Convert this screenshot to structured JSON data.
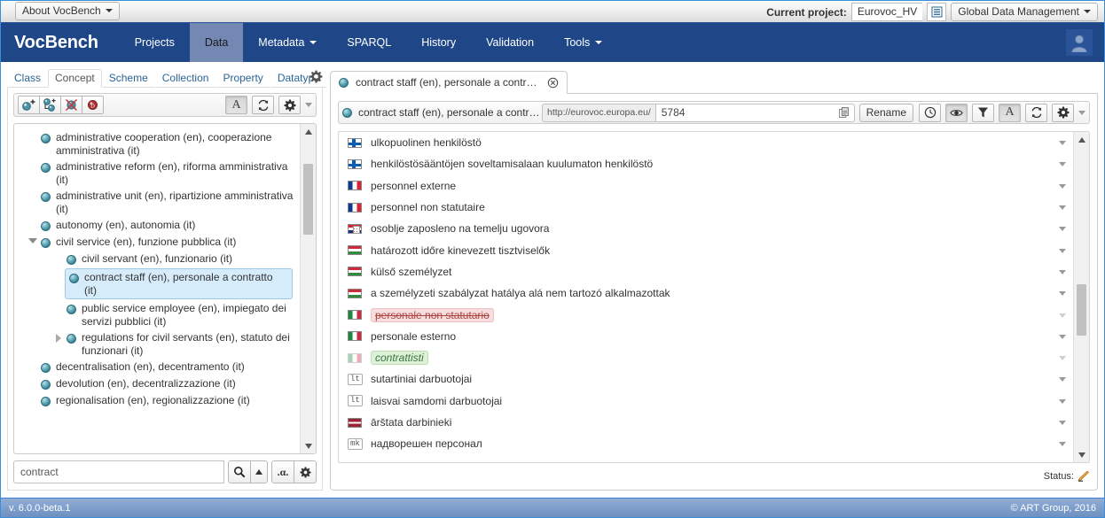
{
  "topbar": {
    "about_label": "About VocBench",
    "current_project_label": "Current project:",
    "project_name": "Eurovoc_HV",
    "project_picker_icon": "list-icon",
    "global_menu_label": "Global Data Management"
  },
  "navbar": {
    "brand": "VocBench",
    "items": [
      {
        "label": "Projects",
        "active": false,
        "has_caret": false
      },
      {
        "label": "Data",
        "active": true,
        "has_caret": false
      },
      {
        "label": "Metadata",
        "active": false,
        "has_caret": true
      },
      {
        "label": "SPARQL",
        "active": false,
        "has_caret": false
      },
      {
        "label": "History",
        "active": false,
        "has_caret": false
      },
      {
        "label": "Validation",
        "active": false,
        "has_caret": false
      },
      {
        "label": "Tools",
        "active": false,
        "has_caret": true
      }
    ],
    "avatar_icon": "user-avatar-icon"
  },
  "left_panel": {
    "tabs": [
      {
        "label": "Class",
        "active": false
      },
      {
        "label": "Concept",
        "active": true
      },
      {
        "label": "Scheme",
        "active": false
      },
      {
        "label": "Collection",
        "active": false
      },
      {
        "label": "Property",
        "active": false
      },
      {
        "label": "Datatype",
        "active": false
      }
    ],
    "tab_settings_icon": "gear-icon",
    "toolbar": {
      "buttons": [
        {
          "name": "create-concept-button",
          "icon": "concept-add-icon"
        },
        {
          "name": "create-narrower-button",
          "icon": "narrower-add-icon"
        },
        {
          "name": "delete-concept-button",
          "icon": "concept-delete-icon"
        },
        {
          "name": "deprecate-concept-button",
          "icon": "concept-deprecate-icon"
        }
      ],
      "right_buttons": [
        {
          "name": "show-labels-button",
          "icon": "letter-a-icon",
          "label": "A",
          "pressed": true
        },
        {
          "name": "refresh-tree-button",
          "icon": "refresh-icon",
          "pressed": false
        },
        {
          "name": "tree-settings-button",
          "icon": "gear-icon",
          "pressed": false
        }
      ],
      "overflow_icon": "caret-down-icon"
    },
    "tree": [
      {
        "label": "administrative cooperation (en), cooperazione amministrativa (it)",
        "indent": 1,
        "twist": "none",
        "selected": false
      },
      {
        "label": "administrative reform (en), riforma amministrativa (it)",
        "indent": 1,
        "twist": "none",
        "selected": false
      },
      {
        "label": "administrative unit (en), ripartizione amministrativa (it)",
        "indent": 1,
        "twist": "none",
        "selected": false
      },
      {
        "label": "autonomy (en), autonomia (it)",
        "indent": 1,
        "twist": "none",
        "selected": false
      },
      {
        "label": "civil service (en), funzione pubblica (it)",
        "indent": 1,
        "twist": "open",
        "selected": false
      },
      {
        "label": "civil servant (en), funzionario (it)",
        "indent": 2,
        "twist": "none",
        "selected": false
      },
      {
        "label": "contract staff (en), personale a contratto (it)",
        "indent": 2,
        "twist": "none",
        "selected": true
      },
      {
        "label": "public service employee (en), impiegato dei servizi pubblici (it)",
        "indent": 2,
        "twist": "none",
        "selected": false
      },
      {
        "label": "regulations for civil servants (en), statuto dei funzionari (it)",
        "indent": 2,
        "twist": "closed",
        "selected": false
      },
      {
        "label": "decentralisation (en), decentramento (it)",
        "indent": 1,
        "twist": "none",
        "selected": false
      },
      {
        "label": "devolution (en), decentralizzazione (it)",
        "indent": 1,
        "twist": "none",
        "selected": false
      },
      {
        "label": "regionalisation (en), regionalizzazione (it)",
        "indent": 1,
        "twist": "none",
        "selected": false
      }
    ],
    "search": {
      "value": "contract",
      "placeholder": "",
      "search_icon": "magnifier-icon",
      "advanced_icon": "caret-up-icon",
      "alpha_label": ".α.",
      "settings_icon": "gear-icon"
    }
  },
  "right_panel": {
    "tab": {
      "label": "contract staff (en), personale a contr…",
      "bullet_icon": "concept-sphere-icon",
      "close_icon": "close-circle-icon"
    },
    "resource": {
      "title": "contract staff (en), personale a contr…",
      "bullet_icon": "concept-sphere-icon",
      "uri_prefix": "http://eurovoc.europa.eu/",
      "uri_local": "5784",
      "copy_icon": "copy-uri-icon",
      "rename_label": "Rename",
      "buttons": [
        {
          "name": "history-button",
          "icon": "clock-icon",
          "pressed": false
        },
        {
          "name": "preview-button",
          "icon": "eye-icon",
          "pressed": true
        },
        {
          "name": "filter-button",
          "icon": "funnel-icon",
          "pressed": false
        },
        {
          "name": "labels-button",
          "icon": "letter-a-icon",
          "label": "A",
          "pressed": true
        },
        {
          "name": "refresh-button",
          "icon": "refresh-icon",
          "pressed": false
        },
        {
          "name": "settings-button",
          "icon": "gear-icon",
          "pressed": false
        }
      ],
      "overflow_icon": "caret-down-icon"
    },
    "values": [
      {
        "flag": "fi",
        "lang_badge": null,
        "text": "ulkopuolinen henkilöstö",
        "state": "normal"
      },
      {
        "flag": "fi",
        "lang_badge": null,
        "text": "henkilöstösääntöjen soveltamisalaan kuulumaton henkilöstö",
        "state": "normal"
      },
      {
        "flag": "fr",
        "lang_badge": null,
        "text": "personnel externe",
        "state": "normal"
      },
      {
        "flag": "fr",
        "lang_badge": null,
        "text": "personnel non statutaire",
        "state": "normal"
      },
      {
        "flag": "hr",
        "lang_badge": null,
        "text": "osoblje zaposleno na temelju ugovora",
        "state": "normal"
      },
      {
        "flag": "hu",
        "lang_badge": null,
        "text": "határozott időre kinevezett tisztviselők",
        "state": "normal"
      },
      {
        "flag": "hu",
        "lang_badge": null,
        "text": "külső személyzet",
        "state": "normal"
      },
      {
        "flag": "hu",
        "lang_badge": null,
        "text": "a személyzeti szabályzat hatálya alá nem tartozó alkalmazottak",
        "state": "normal"
      },
      {
        "flag": "it",
        "lang_badge": null,
        "text": "personale non statutario",
        "state": "deprecated"
      },
      {
        "flag": "it",
        "lang_badge": null,
        "text": "personale esterno",
        "state": "normal"
      },
      {
        "flag": "it",
        "lang_badge": null,
        "text": "contrattisti",
        "state": "proposed"
      },
      {
        "flag": null,
        "lang_badge": "lt",
        "text": "sutartiniai darbuotojai",
        "state": "normal"
      },
      {
        "flag": null,
        "lang_badge": "lt",
        "text": "laisvai samdomi darbuotojai",
        "state": "normal"
      },
      {
        "flag": "lv",
        "lang_badge": null,
        "text": "ārštata darbinieki",
        "state": "normal"
      },
      {
        "flag": null,
        "lang_badge": "mk",
        "text": "надворешен персонал",
        "state": "normal"
      }
    ],
    "status": {
      "label": "Status:",
      "icon": "status-pen-icon"
    }
  },
  "footer": {
    "version": "v. 6.0.0-beta.1",
    "copyright": "© ART Group, 2016"
  },
  "colors": {
    "navbar": "#1f4788",
    "nav_active": "#7389b4",
    "selection": "#d7ecfb",
    "deprecated_text": "#a94442",
    "deprecated_bg": "#f7dddd",
    "proposed_text": "#3c763d",
    "proposed_bg": "#ddf0d8",
    "footer_start": "#94aed4",
    "footer_end": "#6d8fc0"
  }
}
